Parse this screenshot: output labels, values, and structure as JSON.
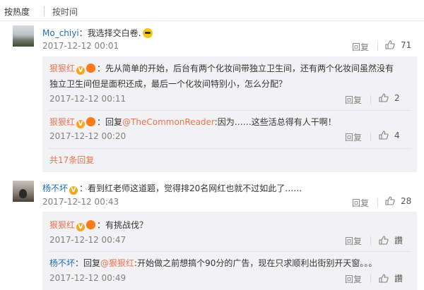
{
  "sort": {
    "hot": "按热度",
    "time": "按时间"
  },
  "comments": [
    {
      "user": "Mo_chiyi",
      "text": "：我选择交白卷.",
      "time": "2017-12-12 00:01",
      "reply_label": "回复",
      "likes": "71",
      "replies": [
        {
          "user": "狠狠红",
          "text_line1": "：先从简单的开始，后台有两个化妆间带独立卫生间，还有两个化妆间虽然没有",
          "text_line2": "独立卫生间但是面积还成，最后一个化妆间特别小，怎么分配？",
          "time": "2017-12-12 00:11",
          "reply_label": "回复",
          "likes": "2"
        },
        {
          "user": "狠狠红",
          "prefix": "：回复",
          "mention": "@TheCommonReader",
          "text": ":因为……这些活总得有人干啊！",
          "time": "2017-12-12 00:20",
          "reply_label": "回复",
          "likes": "4"
        }
      ],
      "more": "共17条回复"
    },
    {
      "user": "杨不坏",
      "text": "：看到红老师这道题，觉得排20名网红也就不过如此了……",
      "time": "2017-12-12 00:43",
      "reply_label": "回复",
      "likes": "28",
      "replies": [
        {
          "user": "狠狠红",
          "text": "：有挑战伐？",
          "time": "2017-12-12 00:47",
          "reply_label": "回复",
          "likes": "讚"
        },
        {
          "user": "杨不坏",
          "prefix": "：回复",
          "mention": "@狠狠红",
          "text": ":开始做之前想搞个90分的广告，现在只求顺利出街别开天窗。。。",
          "time": "2017-12-12 00:49",
          "reply_label": "回复",
          "likes": "讚"
        }
      ]
    }
  ]
}
